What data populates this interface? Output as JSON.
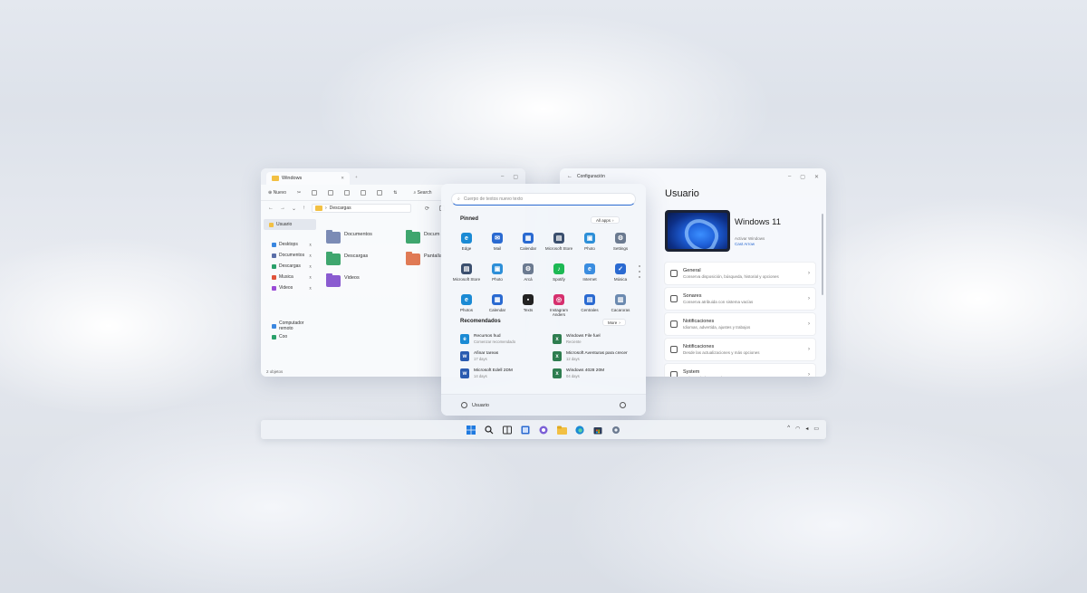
{
  "explorer": {
    "tab_title": "Windows",
    "toolbar": {
      "new_label": "Nuevo",
      "search_label": "Search"
    },
    "address": "Descargas",
    "sidebar": [
      {
        "label": "Usuario",
        "color": "#f2c043",
        "selected": true
      },
      {
        "label": "Desktops",
        "color": "#3a87e0",
        "pinned": true
      },
      {
        "label": "Documentos",
        "color": "#5a6ea8",
        "pinned": true
      },
      {
        "label": "Descargas",
        "color": "#2aa06a",
        "pinned": true
      },
      {
        "label": "Musica",
        "color": "#e0533a",
        "pinned": true
      },
      {
        "label": "Videos",
        "color": "#9a4bd6",
        "pinned": true
      },
      {
        "label": "Computador remoto",
        "color": "#3a87e0"
      },
      {
        "label": "Coo",
        "color": "#2aa06a"
      }
    ],
    "files": [
      {
        "name": "Documentos",
        "sub": "",
        "color": "#7b8bb5"
      },
      {
        "name": "Descargas",
        "sub": "",
        "color": "#3fa66e"
      },
      {
        "name": "Videos",
        "sub": "",
        "color": "#8a5bd0"
      },
      {
        "name": "Docum",
        "sub": "",
        "color": "#3fa66e"
      },
      {
        "name": "Pantalla",
        "sub": "",
        "color": "#e07a55"
      }
    ],
    "status": "2 objetos"
  },
  "settings": {
    "window_title": "Configuración",
    "heading": "Usuario",
    "os_name": "Windows 11",
    "os_sub": "Activar Windows",
    "os_link": "Cast Arrow",
    "cards": [
      {
        "title": "General",
        "sub": "Conserva disposición, búsqueda, historial y opciones"
      },
      {
        "title": "Sonares",
        "sub": "Conserva atribuida con sistema vacías"
      },
      {
        "title": "Notificaciones",
        "sub": "Idiomas, advertida, ajustes y trabajos"
      },
      {
        "title": "Notificaciones",
        "sub": "Desde las actualizaciones y más opciones"
      },
      {
        "title": "System",
        "sub": "Activar Windows Update"
      }
    ]
  },
  "start": {
    "search_placeholder": "Cuerpo de textos nuevo texto",
    "pinned_title": "Pinned",
    "all_apps_label": "All apps",
    "pinned": [
      {
        "label": "Edge",
        "color": "#1a8ad4",
        "glyph": "e"
      },
      {
        "label": "Mail",
        "color": "#2a6ad1",
        "glyph": "✉"
      },
      {
        "label": "Calendar",
        "color": "#2a6ad1",
        "glyph": "▦"
      },
      {
        "label": "Microsoft Store",
        "color": "#3b4f6e",
        "glyph": "▤"
      },
      {
        "label": "Photo",
        "color": "#2d8fd8",
        "glyph": "▣"
      },
      {
        "label": "Settings",
        "color": "#6b7a90",
        "glyph": "⚙"
      },
      {
        "label": "Microsoft Store",
        "color": "#3b4f6e",
        "glyph": "▤"
      },
      {
        "label": "Photo",
        "color": "#2d8fd8",
        "glyph": "▣"
      },
      {
        "label": "Arcá",
        "color": "#6b7a90",
        "glyph": "⚙"
      },
      {
        "label": "Spotify",
        "color": "#1db954",
        "glyph": "♪"
      },
      {
        "label": "Internet",
        "color": "#3a8de0",
        "glyph": "e"
      },
      {
        "label": "Música",
        "color": "#2a6ad1",
        "glyph": "✓"
      },
      {
        "label": "Photos",
        "color": "#1a8ad4",
        "glyph": "e"
      },
      {
        "label": "Calendar",
        "color": "#2a6ad1",
        "glyph": "▦"
      },
      {
        "label": "Texts",
        "color": "#222222",
        "glyph": "▪"
      },
      {
        "label": "Instagram Anders",
        "color": "#d6306e",
        "glyph": "◎"
      },
      {
        "label": "Centrales",
        "color": "#2a6ad1",
        "glyph": "▤"
      },
      {
        "label": "Cacaroras",
        "color": "#6b8ab0",
        "glyph": "▥"
      }
    ],
    "recommended_title": "Recomendados",
    "more_label": "More",
    "recommended": [
      {
        "name": "Recursos hud",
        "sub": "Comenzar recomendado",
        "color": "#1a8ad4",
        "glyph": "e"
      },
      {
        "name": "Windows File fuel",
        "sub": "Reciente",
        "color": "#2e7d4f",
        "glyph": "x"
      },
      {
        "name": "Afinar tareas",
        "sub": "17 days",
        "color": "#2a5bb0",
        "glyph": "w"
      },
      {
        "name": "Microsoft Aventuras para crecer",
        "sub": "12 days",
        "color": "#2e7d4f",
        "glyph": "x"
      },
      {
        "name": "Microsoft Edell 2DM",
        "sub": "14 days",
        "color": "#2a5bb0",
        "glyph": "w"
      },
      {
        "name": "Windows 4028 20M",
        "sub": "04 days",
        "color": "#2e7d4f",
        "glyph": "x"
      }
    ],
    "user_name": "Usuario"
  },
  "taskbar": {
    "icons": [
      "windows-icon",
      "search-icon",
      "widgets-icon",
      "task-view-icon",
      "chat-icon",
      "file-explorer-icon",
      "edge-icon",
      "store-icon",
      "settings-icon"
    ],
    "tray": [
      "^",
      "wifi",
      "vol",
      "bat"
    ]
  }
}
